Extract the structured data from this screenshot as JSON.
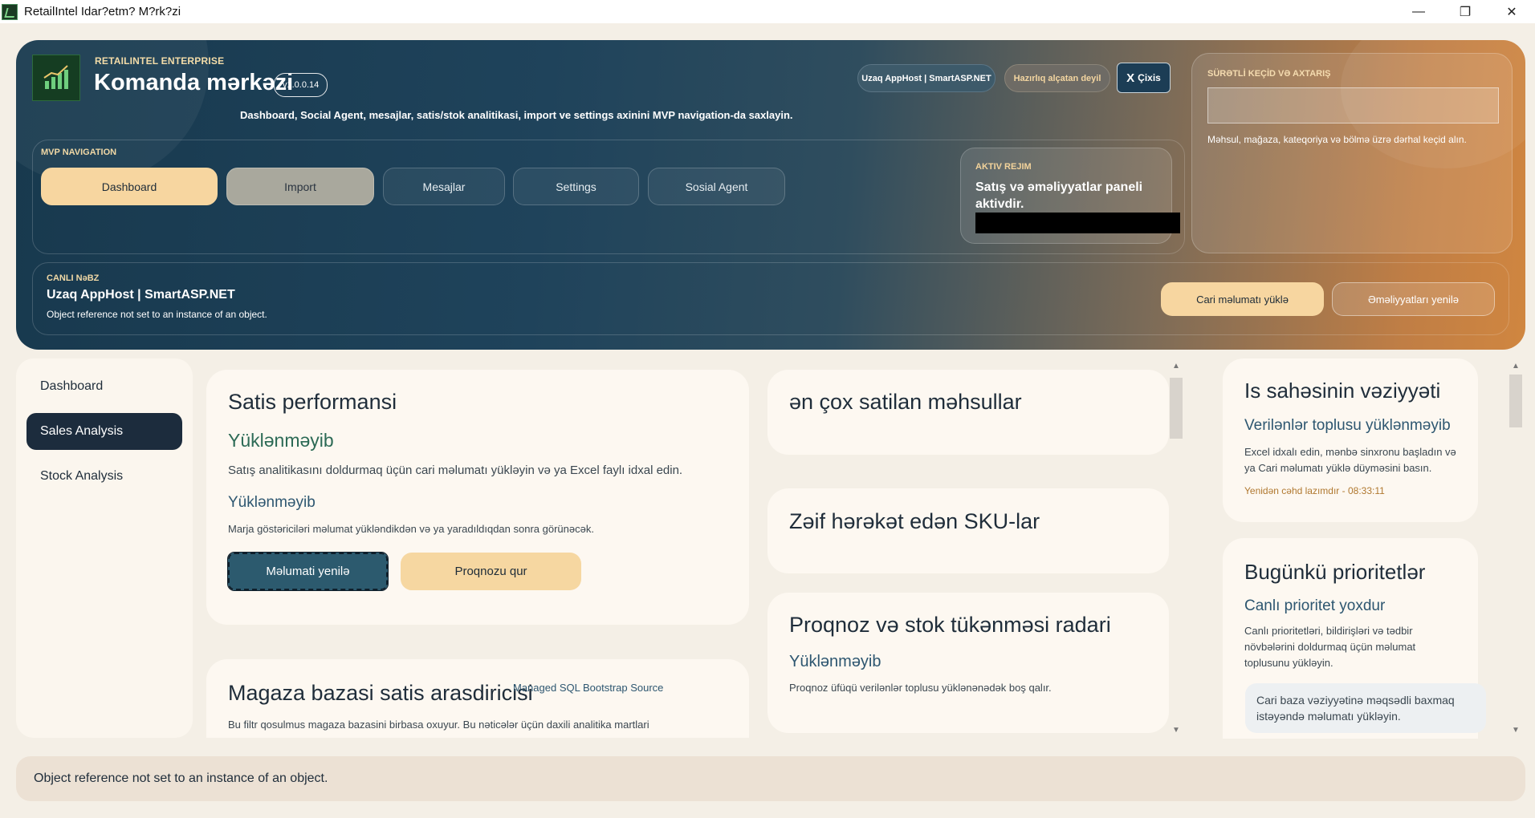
{
  "window": {
    "title": "RetailIntel Idar?etm? M?rk?zi",
    "minimize": "—",
    "maximize": "❐",
    "close": "✕"
  },
  "header": {
    "brand_small": "RETAILINTEL ENTERPRISE",
    "title": "Komanda mərkəzi",
    "version": "v1.0.0.14",
    "subtitle": "Dashboard, Social Agent, mesajlar, satis/stok analitikasi, import ve settings axinini MVP navigation-da saxlayin.",
    "host_pill": "Uzaq AppHost | SmartASP.NET",
    "ready_pill": "Hazırlıq alçatan deyil",
    "exit_x": "X",
    "exit_label": "Çixis"
  },
  "nav": {
    "label": "MVP NAVIGATION",
    "items": [
      "Dashboard",
      "Import",
      "Mesajlar",
      "Settings",
      "Sosial Agent"
    ]
  },
  "mode": {
    "label": "AKTIV REJIM",
    "text": "Satış və əməliyyatlar paneli aktivdir."
  },
  "quick": {
    "label": "SÜRƏTLİ KEÇİD VƏ AXTARIŞ",
    "placeholder": "",
    "hint": "Məhsul, mağaza, kateqoriya və bölmə üzrə dərhal keçid alın."
  },
  "pulse": {
    "label": "CANLI NəBZ",
    "title": "Uzaq AppHost | SmartASP.NET",
    "message": "Object reference not set to an instance of an object.",
    "load_button": "Cari məlumatı yüklə",
    "refresh_ops_button": "Əməliyyatları yenilə"
  },
  "sidebar": {
    "items": [
      "Dashboard",
      "Sales Analysis",
      "Stock Analysis"
    ],
    "active": "Sales Analysis"
  },
  "sales_card": {
    "title": "Satis performansi",
    "status": "Yüklənməyib",
    "desc": "Satış analitikasını doldurmaq üçün cari məlumatı yükləyin və ya Excel faylı idxal edin.",
    "margin_status": "Yüklənməyib",
    "margin_desc": "Marja göstəriciləri məlumat yükləndikdən və ya yaradıldıqdan sonra görünəcək.",
    "refresh_button": "Məlumati yenilə",
    "forecast_button": "Proqnozu qur"
  },
  "store_card": {
    "title": "Magaza bazasi satis arasdiricisi",
    "source": "Managed SQL Bootstrap Source",
    "desc": "Bu filtr qosulmus magaza bazasini birbasa oxuyur. Bu nəticələr üçün daxili analitika martlari"
  },
  "top_products": {
    "title": "ən çox satilan məhsullar"
  },
  "weak_sku": {
    "title": "Zəif hərəkət edən SKU-lar"
  },
  "forecast": {
    "title": "Proqnoz və stok tükənməsi radari",
    "status": "Yüklənməyib",
    "desc": "Proqnoz üfüqü verilənlər toplusu yüklənənədək boş qalır."
  },
  "workspace": {
    "title": "Is sahəsinin vəziyyəti",
    "status": "Verilənlər toplusu yüklənməyib",
    "desc": "Excel idxalı edin, mənbə sinxronu başladın və ya Cari məlumatı yüklə düyməsini basın.",
    "retry": "Yenidən cəhd lazımdır - 08:33:11"
  },
  "priorities": {
    "title": "Bugünkü prioritetlər",
    "status": "Canlı prioritet yoxdur",
    "desc": "Canlı prioritetləri, bildirişləri və tədbir növbələrini doldurmaq üçün məlumat toplusunu yükləyin.",
    "hint": "Cari baza vəziyyətinə məqsədli baxmaq istəyəndə məlumatı yükləyin."
  },
  "footer": {
    "message": "Object reference not set to an instance of an object."
  },
  "colors": {
    "accent": "#f7d6a0",
    "dark_navy": "#1c2c3d",
    "status_green": "#2c6a55",
    "status_blue": "#2d5670",
    "warning_orange": "#b0782f"
  }
}
